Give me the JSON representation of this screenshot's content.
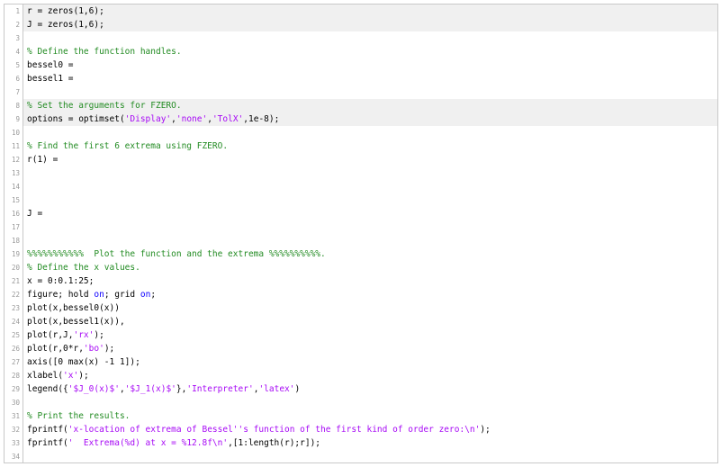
{
  "lines": [
    {
      "num": "1",
      "shaded": true,
      "tokens": [
        {
          "t": "n",
          "v": "r = zeros(1,6);"
        }
      ]
    },
    {
      "num": "2",
      "shaded": true,
      "tokens": [
        {
          "t": "n",
          "v": "J = zeros(1,6);"
        }
      ]
    },
    {
      "num": "3",
      "shaded": false,
      "tokens": []
    },
    {
      "num": "4",
      "shaded": false,
      "tokens": [
        {
          "t": "c",
          "v": "% Define the function handles."
        }
      ]
    },
    {
      "num": "5",
      "shaded": false,
      "tokens": [
        {
          "t": "n",
          "v": "bessel0 ="
        }
      ]
    },
    {
      "num": "6",
      "shaded": false,
      "tokens": [
        {
          "t": "n",
          "v": "bessel1 ="
        }
      ]
    },
    {
      "num": "7",
      "shaded": false,
      "tokens": []
    },
    {
      "num": "8",
      "shaded": true,
      "tokens": [
        {
          "t": "c",
          "v": "% Set the arguments for FZERO."
        }
      ]
    },
    {
      "num": "9",
      "shaded": true,
      "tokens": [
        {
          "t": "n",
          "v": "options = optimset("
        },
        {
          "t": "s",
          "v": "'Display'"
        },
        {
          "t": "n",
          "v": ","
        },
        {
          "t": "s",
          "v": "'none'"
        },
        {
          "t": "n",
          "v": ","
        },
        {
          "t": "s",
          "v": "'TolX'"
        },
        {
          "t": "n",
          "v": ",1e-8);"
        }
      ]
    },
    {
      "num": "10",
      "shaded": false,
      "tokens": []
    },
    {
      "num": "11",
      "shaded": false,
      "tokens": [
        {
          "t": "c",
          "v": "% Find the first 6 extrema using FZERO."
        }
      ]
    },
    {
      "num": "12",
      "shaded": false,
      "tokens": [
        {
          "t": "n",
          "v": "r(1) ="
        }
      ]
    },
    {
      "num": "13",
      "shaded": false,
      "tokens": []
    },
    {
      "num": "14",
      "shaded": false,
      "tokens": []
    },
    {
      "num": "15",
      "shaded": false,
      "tokens": []
    },
    {
      "num": "16",
      "shaded": false,
      "tokens": [
        {
          "t": "n",
          "v": "J ="
        }
      ]
    },
    {
      "num": "17",
      "shaded": false,
      "tokens": []
    },
    {
      "num": "18",
      "shaded": false,
      "tokens": []
    },
    {
      "num": "19",
      "shaded": false,
      "tokens": [
        {
          "t": "c",
          "v": "%%%%%%%%%%%  Plot the function and the extrema %%%%%%%%%%."
        }
      ]
    },
    {
      "num": "20",
      "shaded": false,
      "tokens": [
        {
          "t": "c",
          "v": "% Define the x values."
        }
      ]
    },
    {
      "num": "21",
      "shaded": false,
      "tokens": [
        {
          "t": "n",
          "v": "x = 0:0.1:25;"
        }
      ]
    },
    {
      "num": "22",
      "shaded": false,
      "tokens": [
        {
          "t": "n",
          "v": "figure; hold "
        },
        {
          "t": "k",
          "v": "on"
        },
        {
          "t": "n",
          "v": "; grid "
        },
        {
          "t": "k",
          "v": "on"
        },
        {
          "t": "n",
          "v": ";"
        }
      ]
    },
    {
      "num": "23",
      "shaded": false,
      "tokens": [
        {
          "t": "n",
          "v": "plot(x,bessel0(x))"
        }
      ]
    },
    {
      "num": "24",
      "shaded": false,
      "tokens": [
        {
          "t": "n",
          "v": "plot(x,bessel1(x)),"
        }
      ]
    },
    {
      "num": "25",
      "shaded": false,
      "tokens": [
        {
          "t": "n",
          "v": "plot(r,J,"
        },
        {
          "t": "s",
          "v": "'rx'"
        },
        {
          "t": "n",
          "v": ");"
        }
      ]
    },
    {
      "num": "26",
      "shaded": false,
      "tokens": [
        {
          "t": "n",
          "v": "plot(r,0*r,"
        },
        {
          "t": "s",
          "v": "'bo'"
        },
        {
          "t": "n",
          "v": ");"
        }
      ]
    },
    {
      "num": "27",
      "shaded": false,
      "tokens": [
        {
          "t": "n",
          "v": "axis([0 max(x) -1 1]);"
        }
      ]
    },
    {
      "num": "28",
      "shaded": false,
      "tokens": [
        {
          "t": "n",
          "v": "xlabel("
        },
        {
          "t": "s",
          "v": "'x'"
        },
        {
          "t": "n",
          "v": ");"
        }
      ]
    },
    {
      "num": "29",
      "shaded": false,
      "tokens": [
        {
          "t": "n",
          "v": "legend({"
        },
        {
          "t": "s",
          "v": "'$J_0(x)$'"
        },
        {
          "t": "n",
          "v": ","
        },
        {
          "t": "s",
          "v": "'$J_1(x)$'"
        },
        {
          "t": "n",
          "v": "},"
        },
        {
          "t": "s",
          "v": "'Interpreter'"
        },
        {
          "t": "n",
          "v": ","
        },
        {
          "t": "s",
          "v": "'latex'"
        },
        {
          "t": "n",
          "v": ")"
        }
      ]
    },
    {
      "num": "30",
      "shaded": false,
      "tokens": []
    },
    {
      "num": "31",
      "shaded": false,
      "tokens": [
        {
          "t": "c",
          "v": "% Print the results."
        }
      ]
    },
    {
      "num": "32",
      "shaded": false,
      "tokens": [
        {
          "t": "n",
          "v": "fprintf("
        },
        {
          "t": "s",
          "v": "'x-location of extrema of Bessel''s function of the first kind of order zero:\\n'"
        },
        {
          "t": "n",
          "v": ");"
        }
      ]
    },
    {
      "num": "33",
      "shaded": false,
      "tokens": [
        {
          "t": "n",
          "v": "fprintf("
        },
        {
          "t": "s",
          "v": "'  Extrema(%d) at x = %12.8f\\n'"
        },
        {
          "t": "n",
          "v": ",[1:length(r);r]);"
        }
      ]
    },
    {
      "num": "34",
      "shaded": false,
      "tokens": []
    }
  ]
}
